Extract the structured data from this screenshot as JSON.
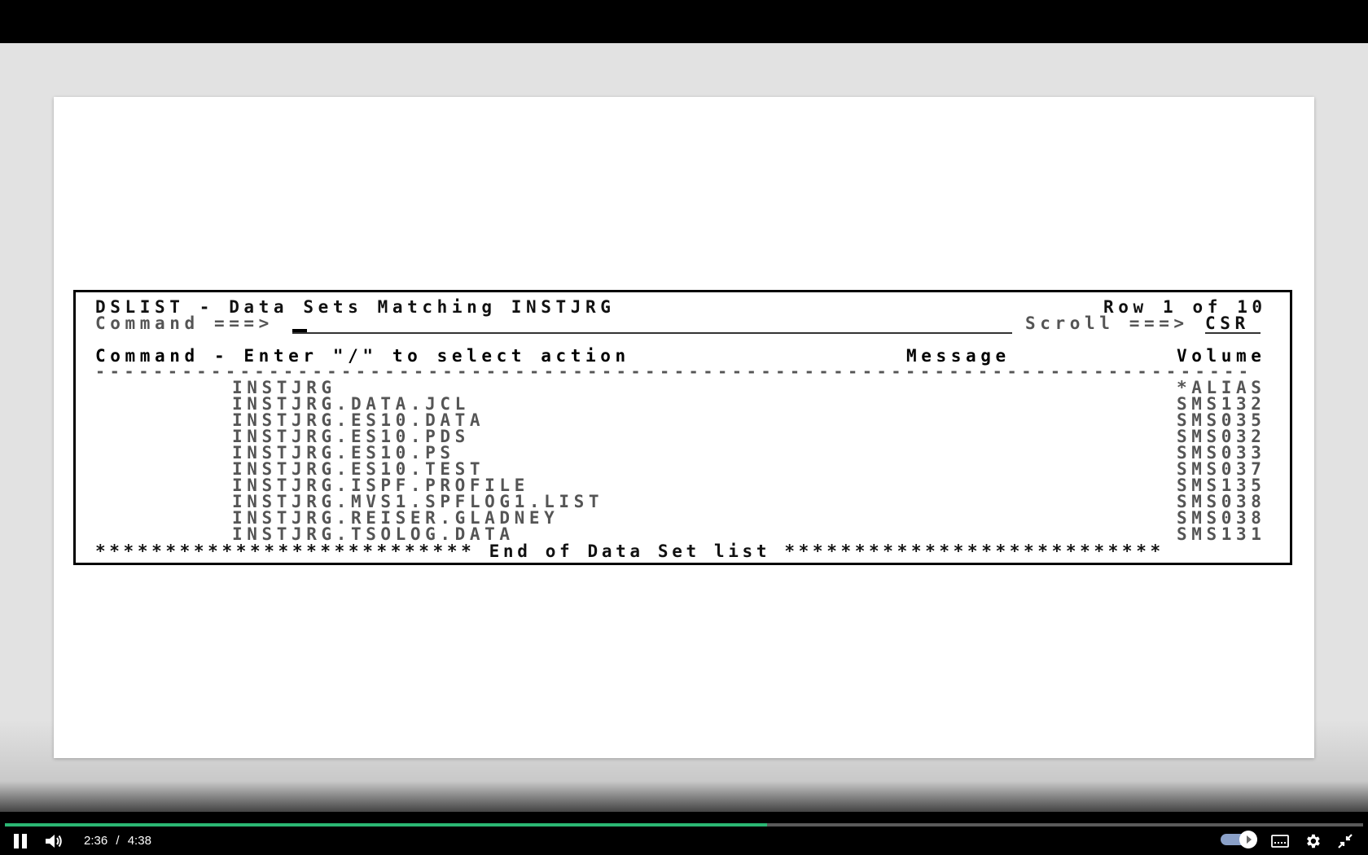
{
  "terminal": {
    "title": "DSLIST - Data Sets Matching INSTJRG",
    "row_info": "Row 1 of 10",
    "command_label": "Command ===>",
    "scroll_label": "Scroll ===>",
    "scroll_value": "CSR",
    "header_command": "Command - Enter \"/\" to select action",
    "header_message": "Message",
    "header_volume": "Volume",
    "separator": "--------------------------------------------------------------------------------",
    "datasets": [
      {
        "name": "INSTJRG",
        "volume": "*ALIAS"
      },
      {
        "name": "INSTJRG.DATA.JCL",
        "volume": "SMS132"
      },
      {
        "name": "INSTJRG.ES10.DATA",
        "volume": "SMS035"
      },
      {
        "name": "INSTJRG.ES10.PDS",
        "volume": "SMS032"
      },
      {
        "name": "INSTJRG.ES10.PS",
        "volume": "SMS033"
      },
      {
        "name": "INSTJRG.ES10.TEST",
        "volume": "SMS037"
      },
      {
        "name": "INSTJRG.ISPF.PROFILE",
        "volume": "SMS135"
      },
      {
        "name": "INSTJRG.MVS1.SPFLOG1.LIST",
        "volume": "SMS038"
      },
      {
        "name": "INSTJRG.REISER.GLADNEY",
        "volume": "SMS038"
      },
      {
        "name": "INSTJRG.TSOLOG.DATA",
        "volume": "SMS131"
      }
    ],
    "footer": "*************************** End of Data Set list ***************************"
  },
  "player": {
    "current_time": "2:36",
    "separator": "/",
    "duration": "4:38",
    "progress_fraction": 0.561,
    "accent_color": "#2bb673",
    "icons": [
      "pause-icon",
      "volume-icon",
      "autoplay-toggle",
      "captions-icon",
      "settings-icon",
      "exit-fullscreen-icon"
    ]
  }
}
